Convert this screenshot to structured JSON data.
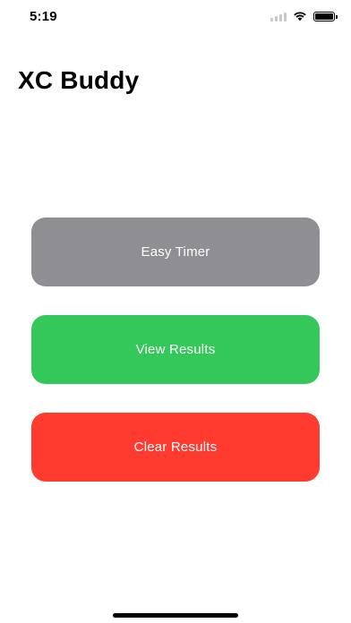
{
  "status_bar": {
    "time": "5:19",
    "icons": [
      "cellular-signal-icon",
      "wifi-icon",
      "battery-icon"
    ]
  },
  "page": {
    "title": "XC Buddy"
  },
  "buttons": [
    {
      "label": "Easy Timer",
      "color": "#8e8e93"
    },
    {
      "label": "View Results",
      "color": "#34c759"
    },
    {
      "label": "Clear Results",
      "color": "#ff3b30"
    }
  ]
}
